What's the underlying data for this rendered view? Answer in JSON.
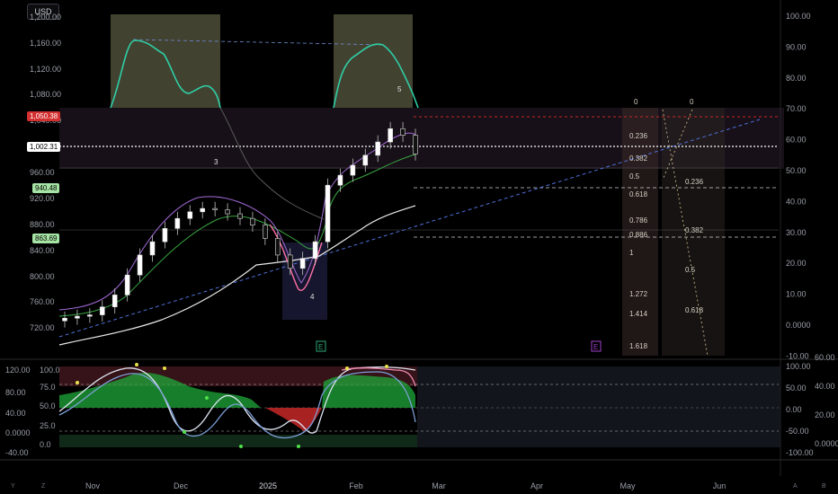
{
  "toolbar": {
    "currency": "USD"
  },
  "price_badges": {
    "red": "1,050.38",
    "white": "1,002.31",
    "green1": "940.48",
    "green2": "863.69"
  },
  "badge_colors": {
    "red": "#d32f2f",
    "white": "#ffffff",
    "green": "#a5e3a5"
  },
  "events": {
    "earnings_label": "E"
  },
  "corners": {
    "bottom_left": "Y",
    "gear": "Z",
    "auto": "A",
    "right": "B"
  },
  "chart_data": [
    {
      "type": "line",
      "panel": "price",
      "left_axis_ticks": [
        "1,200.00",
        "1,160.00",
        "1,120.00",
        "1,080.00",
        "1,040.00",
        "960.00",
        "920.00",
        "880.00",
        "840.00",
        "800.00",
        "760.00",
        "720.00"
      ],
      "right_axis_ticks": [
        "100.00",
        "90.00",
        "80.00",
        "70.00",
        "60.00",
        "50.00",
        "40.00",
        "30.00",
        "20.00",
        "10.00",
        "0.0000",
        "-10.00"
      ],
      "x_tick_labels": [
        "Nov",
        "Dec",
        "2025",
        "Feb",
        "Mar",
        "Apr",
        "May",
        "Jun"
      ],
      "ylim": [
        700,
        1220
      ],
      "wave_labels": [
        "3",
        "4",
        "5"
      ],
      "fib_left": {
        "top": "0",
        "levels": [
          "0.236",
          "0.382",
          "0.5",
          "0.618",
          "0.786",
          "0.886",
          "1",
          "1.272",
          "1.414",
          "1.618"
        ]
      },
      "fib_right": {
        "top": "0",
        "levels": [
          "0.236",
          "0.382",
          "0.5",
          "0.618"
        ]
      },
      "close_series": [
        755,
        758,
        760,
        772,
        790,
        820,
        850,
        870,
        890,
        905,
        915,
        920,
        918,
        912,
        905,
        895,
        875,
        850,
        830,
        845,
        870,
        955,
        970,
        985,
        1000,
        1020,
        1040,
        1030,
        1002
      ]
    },
    {
      "type": "line",
      "panel": "oscillator",
      "left_axis_ticks": [
        "120.00",
        "100.0",
        "80.00",
        "75.0",
        "40.00",
        "50.0",
        "0.0000",
        "25.0",
        "0.0",
        "-40.00"
      ],
      "right_axis_ticks": [
        "100.00",
        "50.00",
        "0.00",
        "-50.00",
        "-100.00"
      ],
      "far_right_ticks": [
        "60.00",
        "40.00",
        "20.00",
        "0.0000"
      ],
      "ylim": [
        -40,
        120
      ]
    }
  ]
}
